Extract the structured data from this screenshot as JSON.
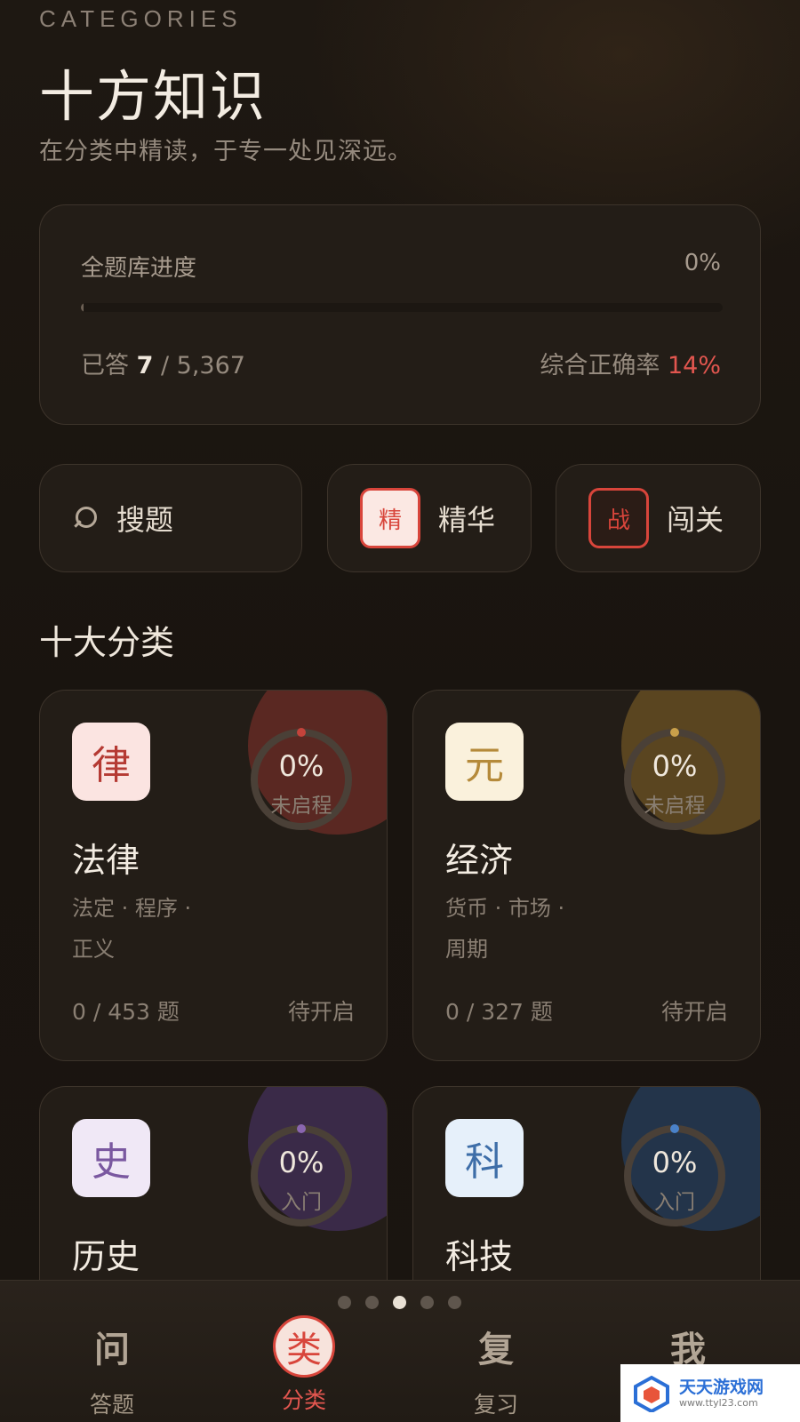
{
  "header": {
    "eyebrow": "CATEGORIES",
    "title": "十方知识",
    "subtitle": "在分类中精读，于专一处见深远。"
  },
  "overall": {
    "label": "全题库进度",
    "percent_text": "0%",
    "progress": 0.004,
    "answered_prefix": "已答",
    "answered": "7",
    "total": "/ 5,367",
    "accuracy_label": "综合正确率",
    "accuracy": "14%"
  },
  "actions": {
    "search_label": "搜题",
    "elite_badge": "精",
    "elite_label": "精华",
    "level_badge": "战",
    "level_label": "闯关"
  },
  "section_title": "十大分类",
  "categories": [
    {
      "glyph": "律",
      "name": "法律",
      "tags_line1": "法定 · 程序 ·",
      "tags_line2": "正义",
      "percent": "0%",
      "status": "未启程",
      "count": "0 / 453 题",
      "state": "待开启",
      "accent": "#c4433b",
      "icon_bg": "#fbe4e1",
      "glyph_color": "#b53a33",
      "glow": "#5a2822"
    },
    {
      "glyph": "元",
      "name": "经济",
      "tags_line1": "货币 · 市场 ·",
      "tags_line2": "周期",
      "percent": "0%",
      "status": "未启程",
      "count": "0 / 327 题",
      "state": "待开启",
      "accent": "#c9a04a",
      "icon_bg": "#faf1dc",
      "glyph_color": "#b58a3a",
      "glow": "#5a4520"
    },
    {
      "glyph": "史",
      "name": "历史",
      "tags_line1": "",
      "tags_line2": "",
      "percent": "0%",
      "status": "入门",
      "count": "",
      "state": "",
      "accent": "#8a66b0",
      "icon_bg": "#f0e8f6",
      "glyph_color": "#7a58a0",
      "glow": "#3a2a48"
    },
    {
      "glyph": "科",
      "name": "科技",
      "tags_line1": "",
      "tags_line2": "",
      "percent": "0%",
      "status": "入门",
      "count": "",
      "state": "",
      "accent": "#4a82c9",
      "icon_bg": "#e6f0fa",
      "glyph_color": "#3e6ea8",
      "glow": "#23344a"
    }
  ],
  "pager": {
    "count": 5,
    "active": 2
  },
  "nav": [
    {
      "glyph": "问",
      "label": "答题",
      "active": false
    },
    {
      "glyph": "类",
      "label": "分类",
      "active": true
    },
    {
      "glyph": "复",
      "label": "复习",
      "active": false
    },
    {
      "glyph": "我",
      "label": "",
      "active": false
    }
  ],
  "watermark": {
    "main": "天天游戏网",
    "sub": "www.ttyl23.com"
  }
}
